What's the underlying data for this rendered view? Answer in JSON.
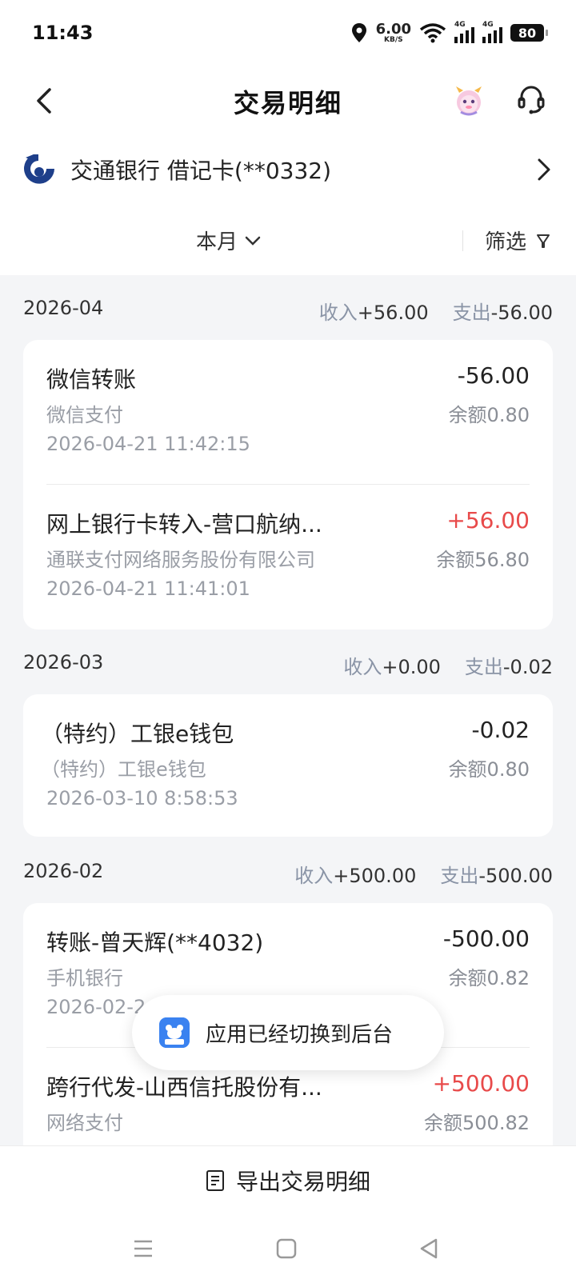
{
  "status": {
    "time": "11:43",
    "net_speed": "6.00",
    "net_unit": "KB/S",
    "sig1": "4G",
    "sig2": "4G",
    "battery": "80"
  },
  "header": {
    "title": "交易明细"
  },
  "account": {
    "name": "交通银行 借记卡(**0332)"
  },
  "filter": {
    "month_label": "本月",
    "filter_label": "筛选"
  },
  "sections": [
    {
      "month": "2026-04",
      "income_label": "收入",
      "income": "+56.00",
      "expense_label": "支出",
      "expense": "-56.00",
      "items": [
        {
          "title": "微信转账",
          "amount": "-56.00",
          "sub": "微信支付",
          "balance": "余额0.80",
          "time": "2026-04-21 11:42:15"
        },
        {
          "title": "网上银行卡转入-营口航纳...",
          "amount": "+56.00",
          "sub": "通联支付网络服务股份有限公司",
          "balance": "余额56.80",
          "time": "2026-04-21 11:41:01"
        }
      ]
    },
    {
      "month": "2026-03",
      "income_label": "收入",
      "income": "+0.00",
      "expense_label": "支出",
      "expense": "-0.02",
      "items": [
        {
          "title": "（特约）工银e钱包",
          "amount": "-0.02",
          "sub": "（特约）工银e钱包",
          "balance": "余额0.80",
          "time": "2026-03-10 8:58:53"
        }
      ]
    },
    {
      "month": "2026-02",
      "income_label": "收入",
      "income": "+500.00",
      "expense_label": "支出",
      "expense": "-500.00",
      "items": [
        {
          "title": "转账-曾天辉(**4032)",
          "amount": "-500.00",
          "sub": "手机银行",
          "balance": "余额0.82",
          "time": "2026-02-2"
        },
        {
          "title": "跨行代发-山西信托股份有...",
          "amount": "+500.00",
          "sub": "网络支付",
          "balance": "余额500.82",
          "time": ""
        }
      ]
    }
  ],
  "toast": {
    "text": "应用已经切换到后台"
  },
  "footer": {
    "export_label": "导出交易明细"
  },
  "colors": {
    "positive": "#e84a4a",
    "muted": "#8a94a6",
    "bg": "#f4f5f7"
  }
}
